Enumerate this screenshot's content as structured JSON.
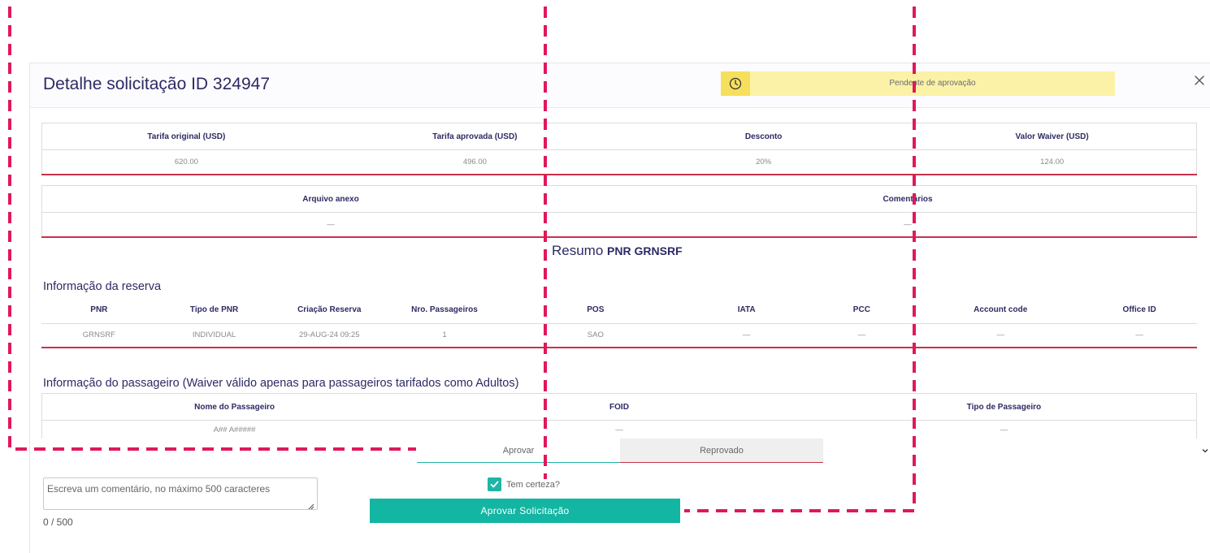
{
  "header": {
    "title": "Detalhe solicitação ID 324947",
    "status": "Pendente de aprovação",
    "status_icon": "clock-icon",
    "close_icon": "close-icon"
  },
  "tariff_table": {
    "headers": [
      "Tarifa original (USD)",
      "Tarifa aprovada (USD)",
      "Desconto",
      "Valor Waiver (USD)"
    ],
    "values": [
      "620.00",
      "496.00",
      "20%",
      "124.00"
    ]
  },
  "attachment_table": {
    "headers": [
      "Arquivo anexo",
      "Comentários"
    ],
    "values": [
      "—",
      "—"
    ]
  },
  "summary": {
    "label": "Resumo",
    "pnr": "PNR GRNSRF"
  },
  "reservation": {
    "title": "Informação da reserva",
    "headers": [
      "PNR",
      "Tipo de PNR",
      "Criação Reserva",
      "Nro. Passageiros",
      "POS",
      "IATA",
      "PCC",
      "Account code",
      "Office ID"
    ],
    "values": [
      "GRNSRF",
      "INDIVIDUAL",
      "29-AUG-24 09:25",
      "1",
      "SAO",
      "—",
      "—",
      "—",
      "—"
    ]
  },
  "passenger": {
    "title": "Informação do passageiro (Waiver válido apenas para passageiros tarifados como Adultos)",
    "headers": [
      "Nome do Passageiro",
      "FOID",
      "Tipo de Passageiro"
    ],
    "values": [
      "A## A#####",
      "—",
      "—"
    ]
  },
  "decision": {
    "approve_tab": "Aprovar",
    "reject_tab": "Reprovado"
  },
  "comment": {
    "placeholder": "Escreva um comentário, no máximo 500 caracteres",
    "value": "",
    "counter": "0 / 500"
  },
  "confirm": {
    "label": "Tem certeza?",
    "checked": true
  },
  "approve_button": "Aprovar Solicitação",
  "colors": {
    "brand": "#2d2a64",
    "accent_teal": "#13b5a3",
    "accent_red": "#c8324b",
    "status_bg": "#fbf2a8",
    "annotation_dash": "#e0185a"
  }
}
